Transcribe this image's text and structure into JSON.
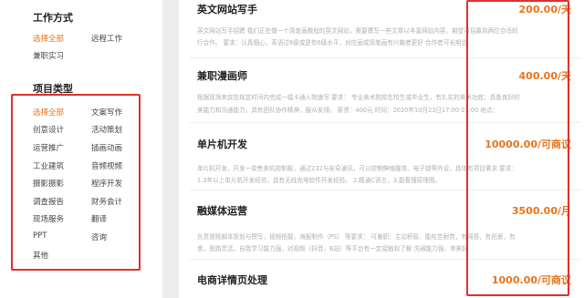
{
  "work_mode": {
    "title": "工作方式",
    "options": [
      "选择全部",
      "远程工作",
      "兼职实习"
    ]
  },
  "project_type": {
    "title": "项目类型",
    "options": [
      "选择全部",
      "文案写作",
      "创意设计",
      "活动策划",
      "运营推广",
      "插画动画",
      "工业建筑",
      "音频视频",
      "摄影摄影",
      "程序开发",
      "调查报告",
      "财务会计",
      "现场服务",
      "翻译",
      "PPT",
      "咨询",
      "其他"
    ]
  },
  "jobs": [
    {
      "title": "英文网站写手",
      "price": "200.00/天",
      "desc": [
        "英文网站写手招聘 我们正在做一个简笔画教程的英文网站，需要撰写一些文章以丰富网站内容，期望可招募到两位合适的",
        "行合作。 要求：认真细心，英语过6级或是有6级水平，对应画或简笔画有兴趣者更好 合作者可长期合"
      ]
    },
    {
      "title": "兼职漫画师",
      "price": "400.00/天",
      "desc": [
        "根据现场来宾在规定时间内完成一幅卡通人物速写 要求： 专业美术院校在校生或毕业生，有扎实的美术功底；具备良好的",
        "美能力和沟通能力，具有团队协作精神，服从安排。 薪资：400元 时间：2020年10月23日17:00-21:00 地点："
      ]
    },
    {
      "title": "单片机开发",
      "price": "10000.00/可商议",
      "desc": [
        "单片机开发，开发一款售卖机控制板，通过232与安卓通讯，可以控制伸缩履带、电子锁等外设，具体有项目需求 要求：",
        "1.3年以上单片机开发经验，具有无线充电软件开发经验。 2.精通C语言，3.能看懂原理图。"
      ]
    },
    {
      "title": "融媒体运营",
      "price": "3500.00/月",
      "desc": [
        "负责视频脚本策划与撰写，视频拍摄，海报制作（PS） 等要求： 可兼职：主动积极、能吃苦耐劳，有网感，有创意，有",
        "意，思路灵活，自我学习能力强，对视频（抖音，B站）等平台有一定接触和了解 沟通能力强，审美好"
      ]
    },
    {
      "title": "电商详情页处理",
      "price": "1000.00/可商议",
      "desc": []
    }
  ],
  "colors": {
    "accent": "#e8731c",
    "highlight_box": "#e0302a"
  }
}
